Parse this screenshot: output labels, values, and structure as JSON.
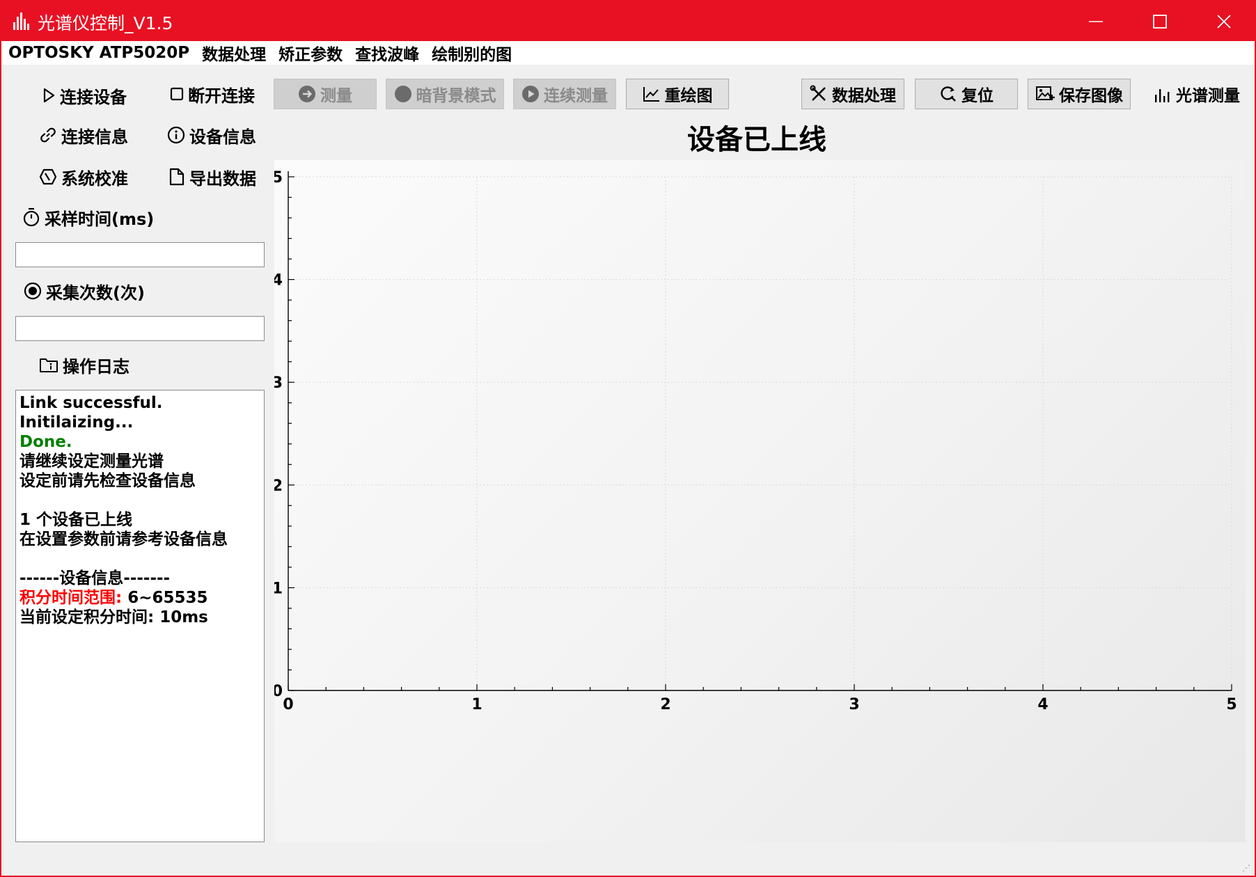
{
  "window": {
    "title": "光谱仪控制_V1.5",
    "accent_color": "#e81123",
    "controls": [
      "minimize-icon",
      "maximize-icon",
      "close-icon"
    ]
  },
  "menu": {
    "items": [
      {
        "label": "OPTOSKY ATP5020P"
      },
      {
        "label": "数据处理"
      },
      {
        "label": "矫正参数"
      },
      {
        "label": "查找波峰"
      },
      {
        "label": "绘制别的图"
      }
    ]
  },
  "left_panel": {
    "connect_device": {
      "label": "连接设备",
      "icon": "play-icon"
    },
    "disconnect": {
      "label": "断开连接",
      "icon": "square-icon"
    },
    "connection_info": {
      "label": "连接信息",
      "icon": "link-icon"
    },
    "device_info": {
      "label": "设备信息",
      "icon": "info-icon"
    },
    "system_calibration": {
      "label": "系统校准",
      "icon": "calibrate-icon"
    },
    "export_data": {
      "label": "导出数据",
      "icon": "file-icon"
    },
    "sampling_time": {
      "label": "采样时间(ms)",
      "icon": "timer-icon",
      "value": ""
    },
    "collection_count": {
      "label": "采集次数(次)",
      "icon": "target-icon",
      "value": ""
    },
    "operation_log": {
      "label": "操作日志",
      "icon": "folder-info-icon"
    }
  },
  "log": {
    "lines": [
      {
        "text": "Link successful.",
        "color": "#000000"
      },
      {
        "text": "Initilaizing...",
        "color": "#000000"
      },
      {
        "text": "Done.",
        "color": "#008000"
      },
      {
        "text": "请继续设定测量光谱",
        "color": "#000000"
      },
      {
        "text": "设定前请先检查设备信息",
        "color": "#000000"
      },
      {
        "text": "",
        "color": "#000000"
      },
      {
        "text": "1 个设备已上线",
        "color": "#000000"
      },
      {
        "text": "在设置参数前请参考设备信息",
        "color": "#000000"
      },
      {
        "text": "",
        "color": "#000000"
      },
      {
        "text": "------设备信息-------",
        "color": "#000000"
      },
      {
        "parts": [
          {
            "text": "积分时间范围: ",
            "color": "#ff0000"
          },
          {
            "text": "6~65535",
            "color": "#000000"
          }
        ]
      },
      {
        "text": "当前设定积分时间: 10ms",
        "color": "#000000"
      }
    ]
  },
  "toolbar": {
    "measure": {
      "label": "测量",
      "icon": "arrow-right-circle-icon",
      "enabled": false
    },
    "dark_mode": {
      "label": "暗背景模式",
      "icon": "moon-icon",
      "enabled": false
    },
    "continuous": {
      "label": "连续测量",
      "icon": "play-circle-icon",
      "enabled": false
    },
    "redraw": {
      "label": "重绘图",
      "icon": "line-chart-icon",
      "enabled": true
    },
    "data_processing": {
      "label": "数据处理",
      "icon": "tools-icon",
      "enabled": true
    },
    "reset": {
      "label": "复位",
      "icon": "search-reset-icon",
      "enabled": true
    },
    "save_image": {
      "label": "保存图像",
      "icon": "image-add-icon",
      "enabled": true
    },
    "spectrum_measure": {
      "label": "光谱测量",
      "icon": "bars-icon",
      "enabled": true
    }
  },
  "chart_data": {
    "type": "line",
    "title": "设备已上线",
    "xlabel": "",
    "ylabel": "",
    "xlim": [
      0,
      5
    ],
    "ylim": [
      0,
      5
    ],
    "xticks": [
      "0",
      "1",
      "2",
      "3",
      "4",
      "5"
    ],
    "yticks": [
      "0",
      "1",
      "2",
      "3",
      "4",
      "5"
    ],
    "grid": true,
    "series": []
  }
}
